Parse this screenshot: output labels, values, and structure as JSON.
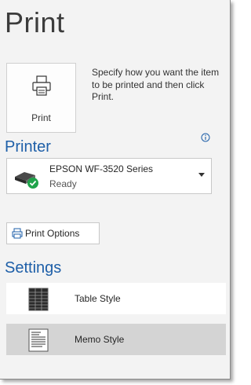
{
  "title": "Print",
  "print_button": {
    "label": "Print",
    "icon": "printer-icon"
  },
  "description": "Specify how you want the item to be printed and then click Print.",
  "printer_section": {
    "heading": "Printer",
    "info_icon": "info-icon",
    "printer": {
      "name": "EPSON WF-3520 Series",
      "status": "Ready",
      "icon": "printer-ready-icon"
    },
    "options_button": {
      "label": "Print Options",
      "icon": "print-options-icon"
    }
  },
  "settings_section": {
    "heading": "Settings",
    "styles": [
      {
        "label": "Table Style",
        "icon": "table-style-icon",
        "selected": false
      },
      {
        "label": "Memo Style",
        "icon": "memo-style-icon",
        "selected": true
      }
    ]
  },
  "colors": {
    "accent": "#1e5fa8",
    "selected_row": "#d4d4d4",
    "ready_check": "#1fa34a"
  }
}
